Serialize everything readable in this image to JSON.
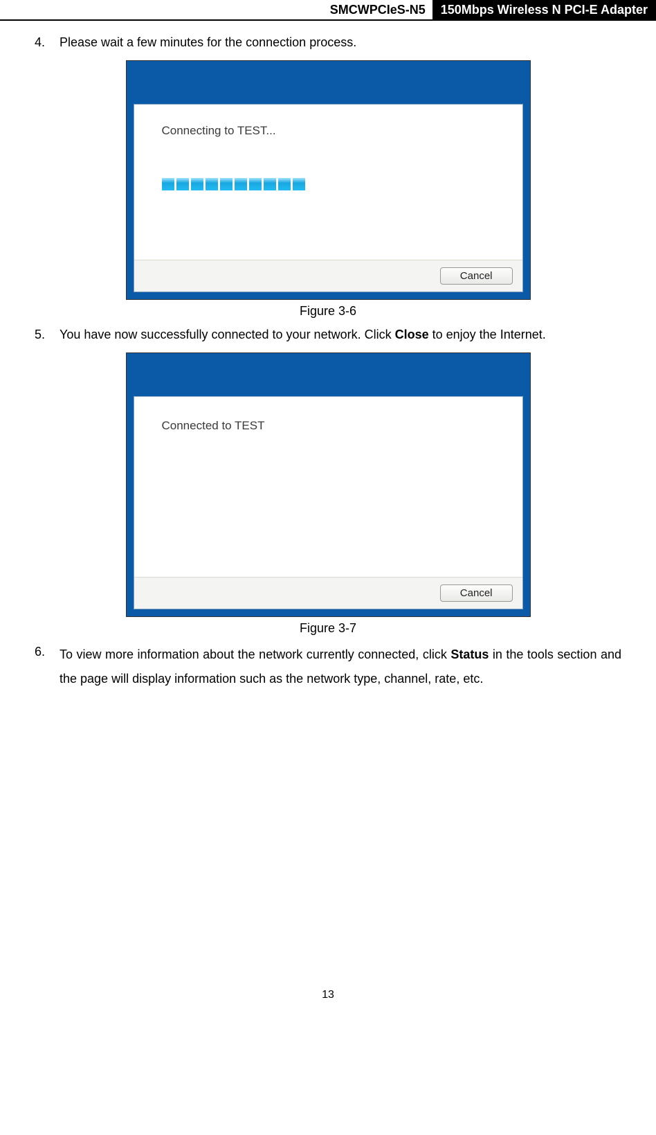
{
  "header": {
    "model": "SMCWPCIeS-N5",
    "title": "150Mbps Wireless N PCI-E Adapter"
  },
  "steps": {
    "s4": {
      "num": "4.",
      "text": "Please wait a few minutes for the connection process."
    },
    "s5": {
      "num": "5.",
      "pre": "You have now successfully connected to your network. Click ",
      "bold": "Close",
      "post": " to enjoy the Internet."
    },
    "s6": {
      "num": "6.",
      "pre": "To view more information about the network currently connected, click ",
      "bold": "Status",
      "post": " in the tools section and the page will display information such as the network type, channel, rate, etc."
    }
  },
  "dialog1": {
    "status": "Connecting to TEST...",
    "button": "Cancel"
  },
  "dialog2": {
    "status": "Connected to TEST",
    "button": "Cancel"
  },
  "captions": {
    "fig36": "Figure 3-6",
    "fig37": "Figure 3-7"
  },
  "page": "13"
}
